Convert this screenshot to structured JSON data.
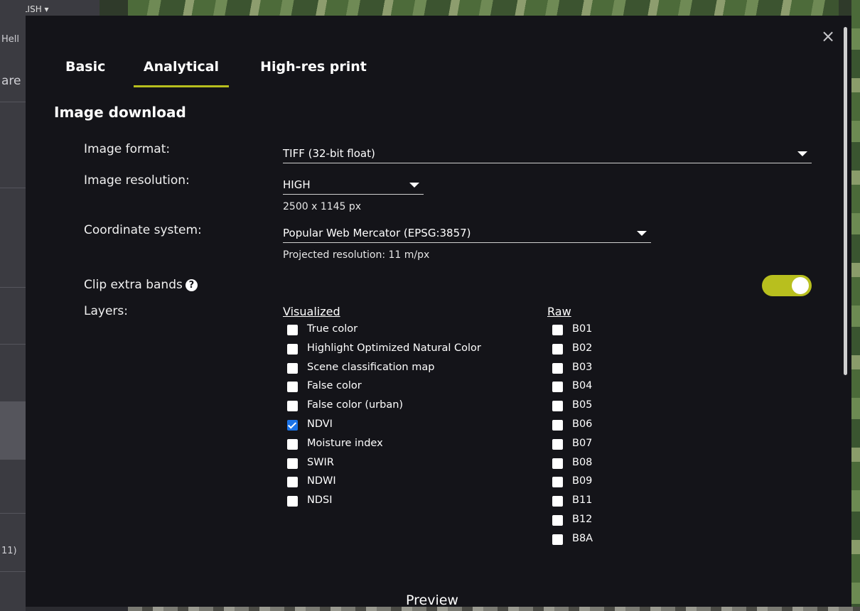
{
  "background": {
    "language_label": "ENGLISH",
    "left_fragments": [
      "Hell",
      "are",
      "11)"
    ]
  },
  "modal": {
    "close_glyph": "×",
    "tabs": [
      {
        "label": "Basic",
        "active": false
      },
      {
        "label": "Analytical",
        "active": true
      },
      {
        "label": "High-res print",
        "active": false
      }
    ],
    "section_title": "Image download",
    "image_format": {
      "label": "Image format:",
      "value": "TIFF (32-bit float)"
    },
    "image_resolution": {
      "label": "Image resolution:",
      "value": "HIGH",
      "size_text": "2500 x 1145 px"
    },
    "coordinate_system": {
      "label": "Coordinate system:",
      "value": "Popular Web Mercator (EPSG:3857)",
      "projected_text": "Projected resolution: 11 m/px"
    },
    "clip_extra_bands": {
      "label": "Clip extra bands",
      "help_glyph": "?",
      "enabled": true
    },
    "layers": {
      "label": "Layers:",
      "visualized_heading": "Visualized",
      "raw_heading": "Raw",
      "visualized": [
        {
          "label": "True color",
          "checked": false
        },
        {
          "label": "Highlight Optimized Natural Color",
          "checked": false
        },
        {
          "label": "Scene classification map",
          "checked": false
        },
        {
          "label": "False color",
          "checked": false
        },
        {
          "label": "False color (urban)",
          "checked": false
        },
        {
          "label": "NDVI",
          "checked": true
        },
        {
          "label": "Moisture index",
          "checked": false
        },
        {
          "label": "SWIR",
          "checked": false
        },
        {
          "label": "NDWI",
          "checked": false
        },
        {
          "label": "NDSI",
          "checked": false
        }
      ],
      "raw": [
        {
          "label": "B01",
          "checked": false
        },
        {
          "label": "B02",
          "checked": false
        },
        {
          "label": "B03",
          "checked": false
        },
        {
          "label": "B04",
          "checked": false
        },
        {
          "label": "B05",
          "checked": false
        },
        {
          "label": "B06",
          "checked": false
        },
        {
          "label": "B07",
          "checked": false
        },
        {
          "label": "B08",
          "checked": false
        },
        {
          "label": "B09",
          "checked": false
        },
        {
          "label": "B11",
          "checked": false
        },
        {
          "label": "B12",
          "checked": false
        },
        {
          "label": "B8A",
          "checked": false
        }
      ]
    },
    "preview_title": "Preview"
  },
  "colors": {
    "accent": "#b8bf1e",
    "modal_bg": "#141419",
    "checkbox_checked": "#1a73e8"
  }
}
